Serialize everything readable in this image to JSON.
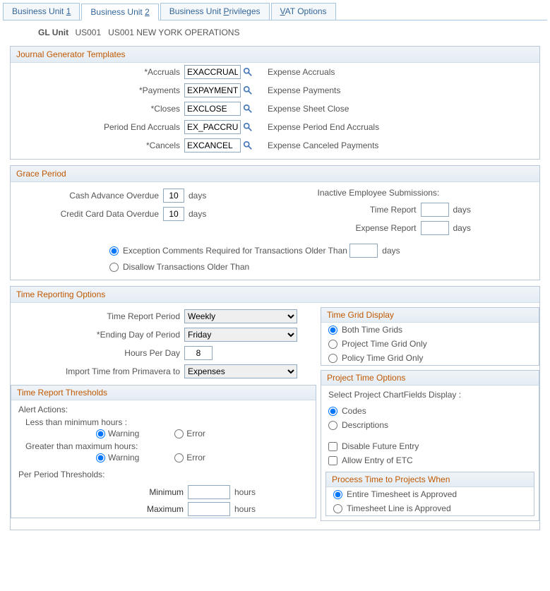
{
  "tabs": {
    "bu1_pre": "Business Unit ",
    "bu1_key": "1",
    "bu2_pre": "Business Unit ",
    "bu2_key": "2",
    "priv_pre": "Business Unit ",
    "priv_key": "P",
    "priv_post": "rivileges",
    "vat_key": "V",
    "vat_post": "AT Options"
  },
  "header": {
    "gl_unit_lbl": "GL Unit",
    "gl_unit_val": "US001",
    "gl_unit_desc": "US001 NEW YORK OPERATIONS"
  },
  "jgt": {
    "title": "Journal Generator Templates",
    "accruals_lbl": "*Accruals",
    "accruals_val": "EXACCRUAL",
    "accruals_desc": "Expense Accruals",
    "payments_lbl": "*Payments",
    "payments_val": "EXPAYMENT",
    "payments_desc": "Expense Payments",
    "closes_lbl": "*Closes",
    "closes_val": "EXCLOSE",
    "closes_desc": "Expense Sheet Close",
    "pea_lbl": "Period End Accruals",
    "pea_val": "EX_PACCRUE",
    "pea_desc": "Expense Period End Accruals",
    "cancels_lbl": "*Cancels",
    "cancels_val": "EXCANCEL",
    "cancels_desc": "Expense Canceled Payments"
  },
  "grace": {
    "title": "Grace Period",
    "cash_lbl": "Cash Advance Overdue",
    "cash_val": "10",
    "credit_lbl": "Credit Card Data Overdue",
    "credit_val": "10",
    "days": "days",
    "inactive_lbl": "Inactive Employee Submissions:",
    "time_report_lbl": "Time Report",
    "time_report_val": "",
    "expense_report_lbl": "Expense Report",
    "expense_report_val": "",
    "exc_lbl": "Exception Comments Required for Transactions Older Than",
    "exc_val": "",
    "disallow_lbl": "Disallow Transactions Older Than"
  },
  "time": {
    "title": "Time Reporting Options",
    "period_lbl": "Time Report Period",
    "period_val": "Weekly",
    "ending_lbl": "*Ending Day of Period",
    "ending_val": "Friday",
    "hours_lbl": "Hours Per Day",
    "hours_val": "8",
    "import_lbl": "Import Time from Primavera to",
    "import_val": "Expenses"
  },
  "thresholds": {
    "title": "Time Report Thresholds",
    "alert_actions": "Alert Actions:",
    "less_than": "Less than minimum hours :",
    "greater_than": "Greater than maximum hours:",
    "warning": "Warning",
    "error": "Error",
    "per_period": "Per Period Thresholds:",
    "min_lbl": "Minimum",
    "min_val": "",
    "max_lbl": "Maximum",
    "max_val": "",
    "hours": "hours"
  },
  "grid": {
    "title": "Time Grid Display",
    "both": "Both Time Grids",
    "project": "Project Time Grid Only",
    "policy": "Policy Time Grid Only"
  },
  "pto": {
    "title": "Project Time Options",
    "select_lbl": "Select Project ChartFields Display :",
    "codes": "Codes",
    "descriptions": "Descriptions",
    "disable_future": "Disable Future Entry",
    "allow_etc": "Allow Entry of ETC"
  },
  "process": {
    "title": "Process Time to Projects When",
    "entire": "Entire Timesheet is Approved",
    "line": "Timesheet Line is Approved"
  }
}
